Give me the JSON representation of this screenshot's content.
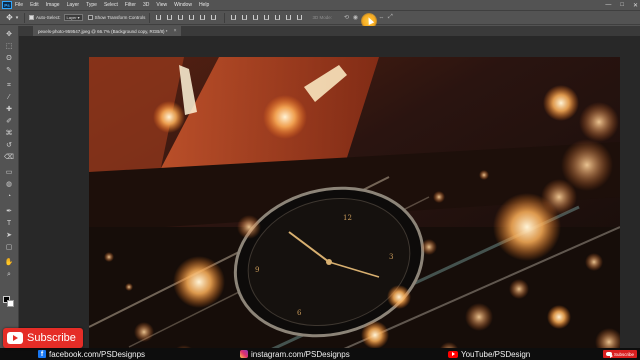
{
  "app": {
    "logo": "Ps"
  },
  "menu": [
    "File",
    "Edit",
    "Image",
    "Layer",
    "Type",
    "Select",
    "Filter",
    "3D",
    "View",
    "Window",
    "Help"
  ],
  "window_controls": {
    "minimize": "—",
    "maximize": "□",
    "close": "✕"
  },
  "options": {
    "auto_select_label": "Auto-Select:",
    "auto_select_checked": true,
    "layer_select_value": "Layer",
    "show_transform_label": "Show Transform Controls",
    "show_transform_checked": false,
    "mode_3d_label": "3D Mode:"
  },
  "document": {
    "tab_title": "pexels-photo-959547.jpeg @ 66.7% (Background copy, RGB/8) *",
    "close_glyph": "×"
  },
  "toolbar": {
    "tools": [
      "move-tool",
      "marquee-tool",
      "lasso-tool",
      "quick-select-tool",
      "crop-tool",
      "eyedropper-tool",
      "healing-brush-tool",
      "brush-tool",
      "clone-stamp-tool",
      "history-brush-tool",
      "eraser-tool",
      "gradient-tool",
      "blur-tool",
      "dodge-tool",
      "pen-tool",
      "type-tool",
      "path-selection-tool",
      "rectangle-tool",
      "hand-tool",
      "zoom-tool"
    ],
    "glyphs": [
      "✥",
      "⬚",
      "ʘ",
      "✎",
      "⌗",
      "⁄",
      "✚",
      "✐",
      "⌘",
      "↺",
      "⌫",
      "▭",
      "◍",
      "◔",
      "✒",
      "T",
      "➤",
      "▢",
      "✋",
      "⌕"
    ],
    "foreground_color": "#000000",
    "background_color": "#ffffff"
  },
  "social": {
    "facebook": "facebook.com/PSDesignps",
    "instagram": "instagram.com/PSDesignps",
    "youtube": "YouTube/PSDesign",
    "subscribe_mini": "Subscribe"
  },
  "subscribe_button": {
    "label": "Subscribe",
    "color": "#e52d27"
  },
  "accent": {
    "cursor_highlight": "#f5a91f"
  }
}
